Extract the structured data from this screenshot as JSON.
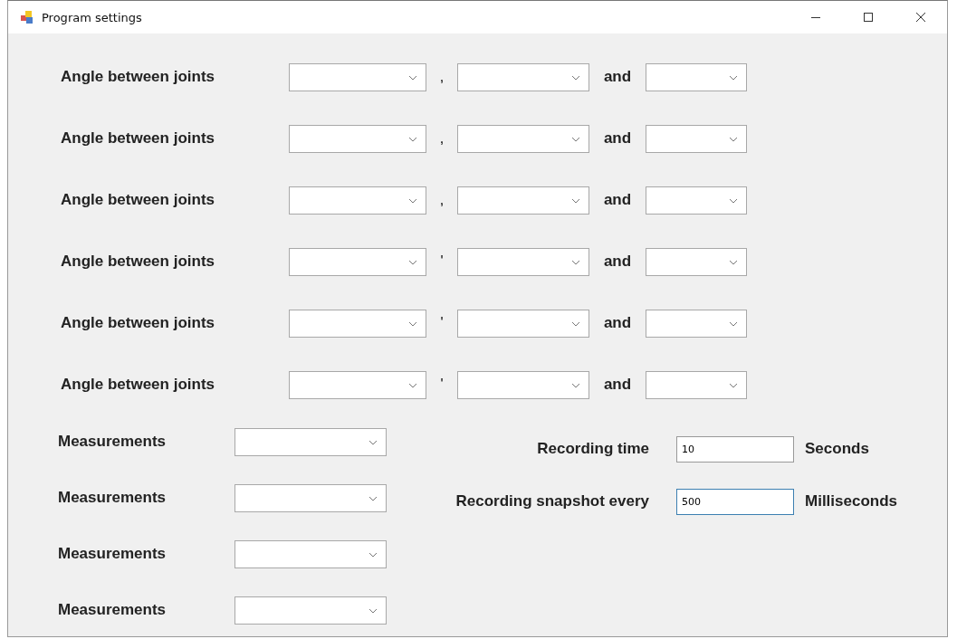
{
  "window": {
    "title": "Program settings"
  },
  "angle_rows": [
    {
      "label": "Angle between joints",
      "separator": ",",
      "conjunction": "and"
    },
    {
      "label": "Angle between joints",
      "separator": ",",
      "conjunction": "and"
    },
    {
      "label": "Angle between joints",
      "separator": ",",
      "conjunction": "and"
    },
    {
      "label": "Angle between joints",
      "separator": "'",
      "conjunction": "and"
    },
    {
      "label": "Angle between joints",
      "separator": "'",
      "conjunction": "and"
    },
    {
      "label": "Angle between joints",
      "separator": "'",
      "conjunction": "and"
    }
  ],
  "measurements": [
    {
      "label": "Measurements"
    },
    {
      "label": "Measurements"
    },
    {
      "label": "Measurements"
    },
    {
      "label": "Measurements"
    }
  ],
  "recording": [
    {
      "label": "Recording time",
      "value": "10",
      "unit": "Seconds",
      "focused": false
    },
    {
      "label": "Recording snapshot every",
      "value": "500",
      "unit": "Milliseconds",
      "focused": true
    }
  ]
}
